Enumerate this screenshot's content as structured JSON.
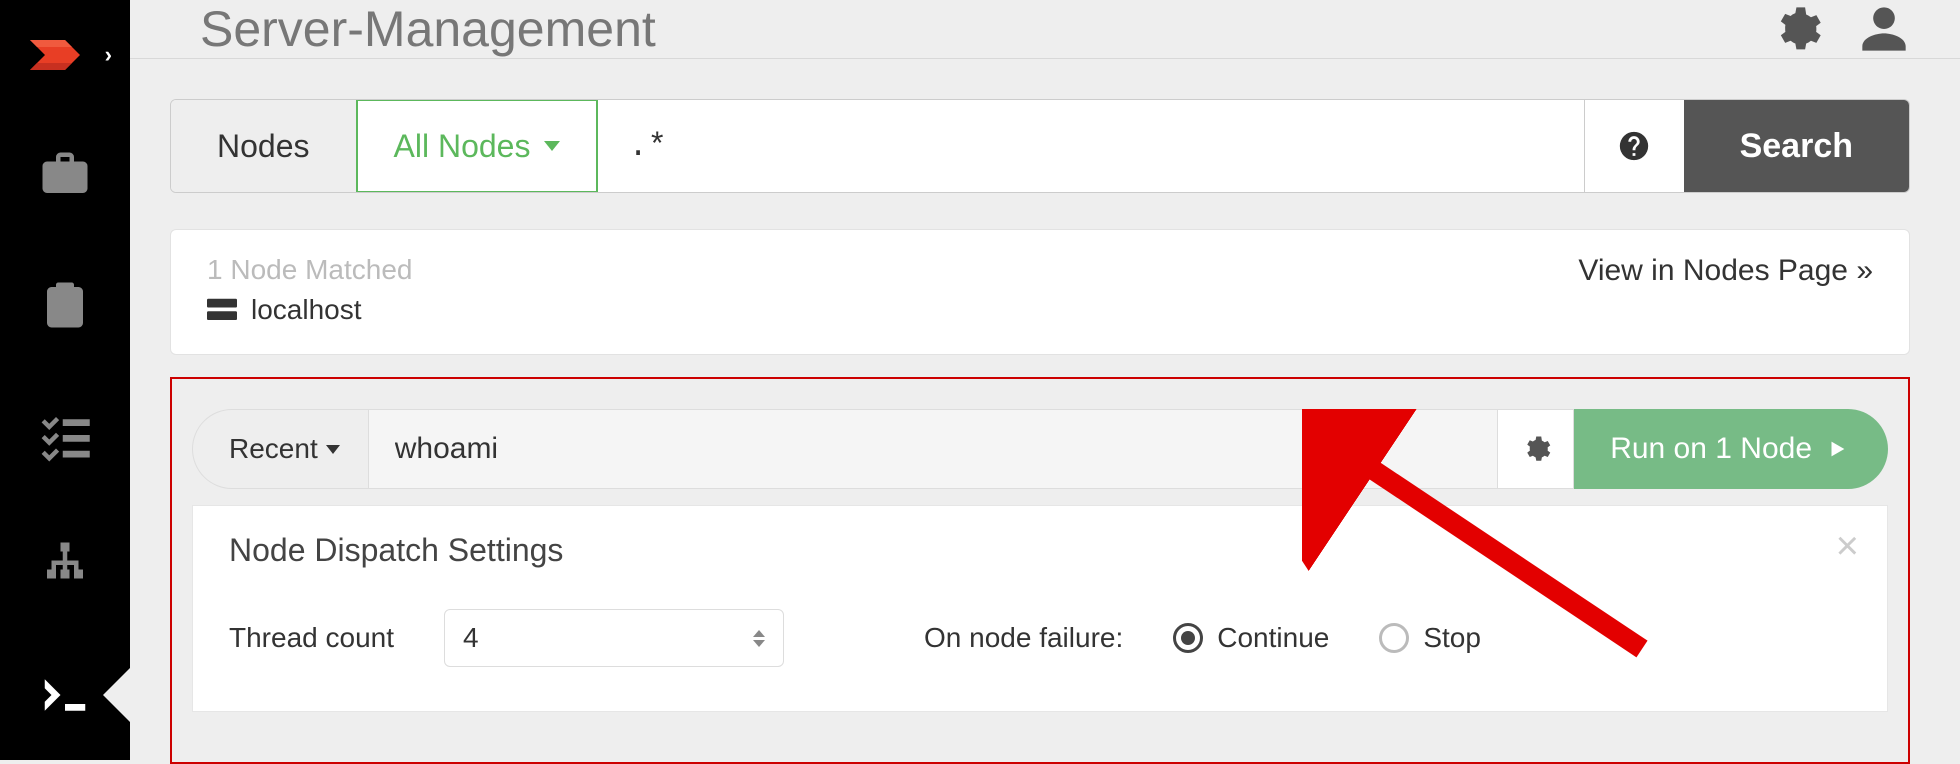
{
  "header": {
    "title": "Server-Management"
  },
  "filter": {
    "label": "Nodes",
    "dropdown": "All Nodes",
    "pattern": ".*",
    "search_label": "Search"
  },
  "matched": {
    "count_text": "1 Node Matched",
    "host": "localhost",
    "view_link": "View in Nodes Page »"
  },
  "command": {
    "recent_label": "Recent",
    "value": "whoami",
    "run_label": "Run on 1 Node"
  },
  "dispatch": {
    "title": "Node Dispatch Settings",
    "thread_label": "Thread count",
    "thread_value": "4",
    "failure_label": "On node failure:",
    "option_continue": "Continue",
    "option_stop": "Stop",
    "selected": "continue"
  }
}
